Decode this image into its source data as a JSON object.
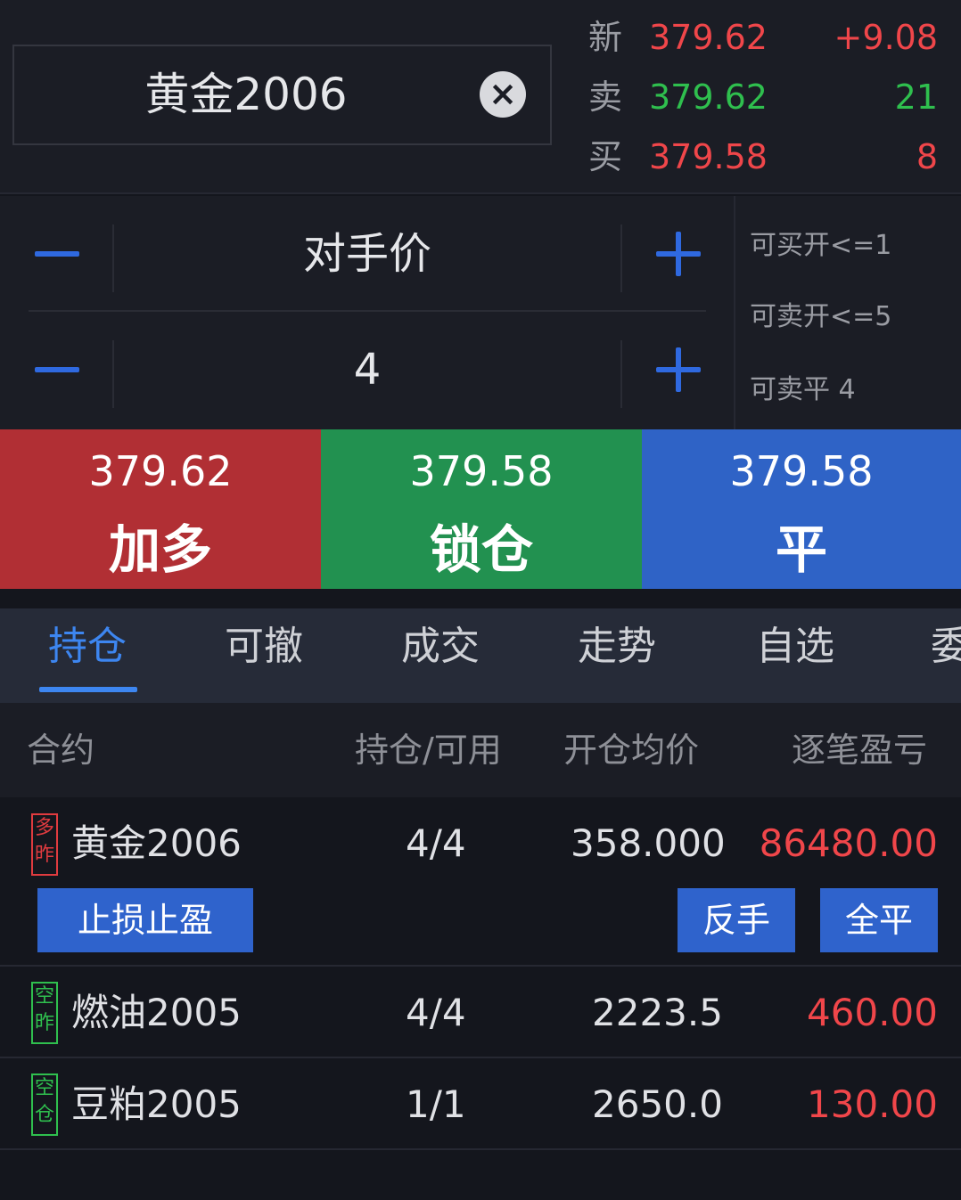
{
  "contract": {
    "name": "黄金2006"
  },
  "quotes": [
    {
      "label": "新",
      "price": "379.62",
      "volume": "+9.08",
      "price_color": "#f0464a",
      "volume_color": "#f0464a"
    },
    {
      "label": "卖",
      "price": "379.62",
      "volume": "21",
      "price_color": "#2fbf4e",
      "volume_color": "#2fbf4e"
    },
    {
      "label": "买",
      "price": "379.58",
      "volume": "8",
      "price_color": "#f0464a",
      "volume_color": "#f0464a"
    }
  ],
  "price_stepper": {
    "value": "对手价"
  },
  "qty_stepper": {
    "value": "4"
  },
  "availability": [
    "可买开<=1",
    "可卖开<=5",
    "可卖平 4"
  ],
  "actions": [
    {
      "price": "379.62",
      "label": "加多",
      "color": "#b12f34"
    },
    {
      "price": "379.58",
      "label": "锁仓",
      "color": "#229150"
    },
    {
      "price": "379.58",
      "label": "平",
      "color": "#2f63c6"
    }
  ],
  "tabs": [
    "持仓",
    "可撤",
    "成交",
    "走势",
    "自选",
    "委"
  ],
  "active_tab": "持仓",
  "table": {
    "headers": [
      "合约",
      "持仓/可用",
      "开仓均价",
      "逐笔盈亏"
    ],
    "rows": [
      {
        "badge_top": "多",
        "badge_bottom": "昨",
        "side": "long",
        "contract": "黄金2006",
        "position": "4/4",
        "avg_price": "358.000",
        "pnl": "86480.00"
      },
      {
        "badge_top": "空",
        "badge_bottom": "昨",
        "side": "short",
        "contract": "燃油2005",
        "position": "4/4",
        "avg_price": "2223.5",
        "pnl": "460.00"
      },
      {
        "badge_top": "空",
        "badge_bottom": "仓",
        "side": "short",
        "contract": "豆粕2005",
        "position": "1/1",
        "avg_price": "2650.0",
        "pnl": "130.00"
      }
    ],
    "row_actions": {
      "stop_loss": "止损止盈",
      "reverse": "反手",
      "close_all": "全平"
    }
  }
}
